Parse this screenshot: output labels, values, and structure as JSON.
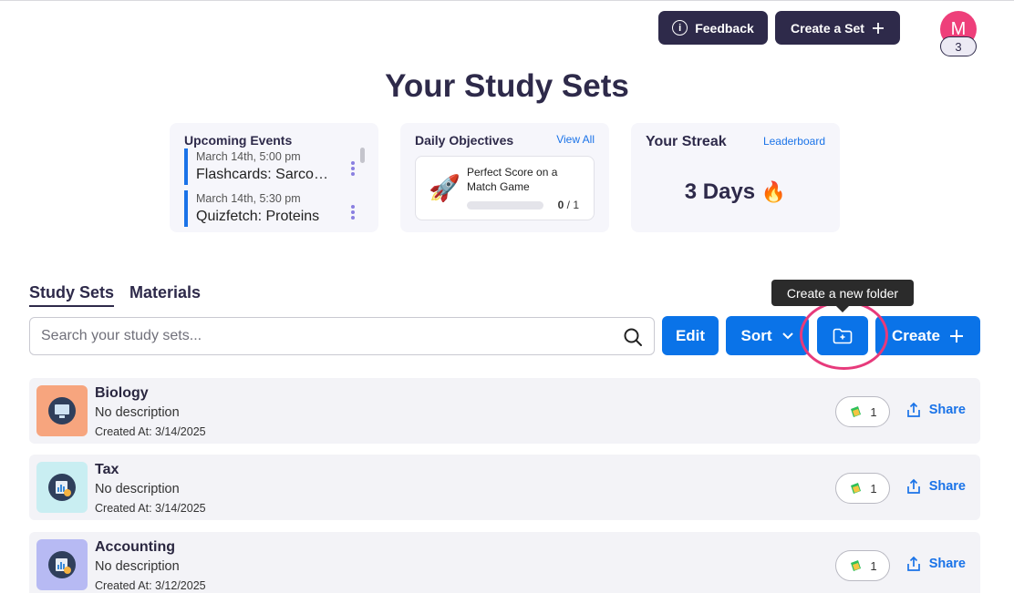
{
  "header": {
    "feedback_label": "Feedback",
    "create_set_label": "Create a Set",
    "avatar_initial": "M",
    "avatar_badge": "3"
  },
  "page_title": "Your Study Sets",
  "upcoming_events": {
    "title": "Upcoming Events",
    "items": [
      {
        "time": "March 14th, 5:00 pm",
        "name": "Flashcards: Sarcomere"
      },
      {
        "time": "March 14th, 5:30 pm",
        "name": "Quizfetch: Proteins"
      }
    ]
  },
  "daily_objectives": {
    "title": "Daily Objectives",
    "view_all": "View All",
    "objective": {
      "text": "Perfect Score on a Match Game",
      "done": "0",
      "total": "/ 1",
      "progress": 0
    }
  },
  "streak": {
    "title": "Your Streak",
    "leaderboard": "Leaderboard",
    "value": "3 Days",
    "emoji": "🔥"
  },
  "tabs": [
    {
      "label": "Study Sets",
      "active": true
    },
    {
      "label": "Materials",
      "active": false
    }
  ],
  "toolbar": {
    "search_placeholder": "Search your study sets...",
    "edit_label": "Edit",
    "sort_label": "Sort",
    "create_label": "Create",
    "folder_tooltip": "Create a new folder"
  },
  "study_sets": [
    {
      "name": "Biology",
      "description": "No description",
      "created": "Created At: 3/14/2025",
      "count": "1",
      "share": "Share",
      "thumb_color": "#f7a57e"
    },
    {
      "name": "Tax",
      "description": "No description",
      "created": "Created At: 3/14/2025",
      "count": "1",
      "share": "Share",
      "thumb_color": "#c9eef2"
    },
    {
      "name": "Accounting",
      "description": "No description",
      "created": "Created At: 3/12/2025",
      "count": "1",
      "share": "Share",
      "thumb_color": "#b7baf3"
    }
  ],
  "colors": {
    "primary": "#0a73e8",
    "dark": "#2e2a4a",
    "accent_pink": "#e73a7b"
  }
}
